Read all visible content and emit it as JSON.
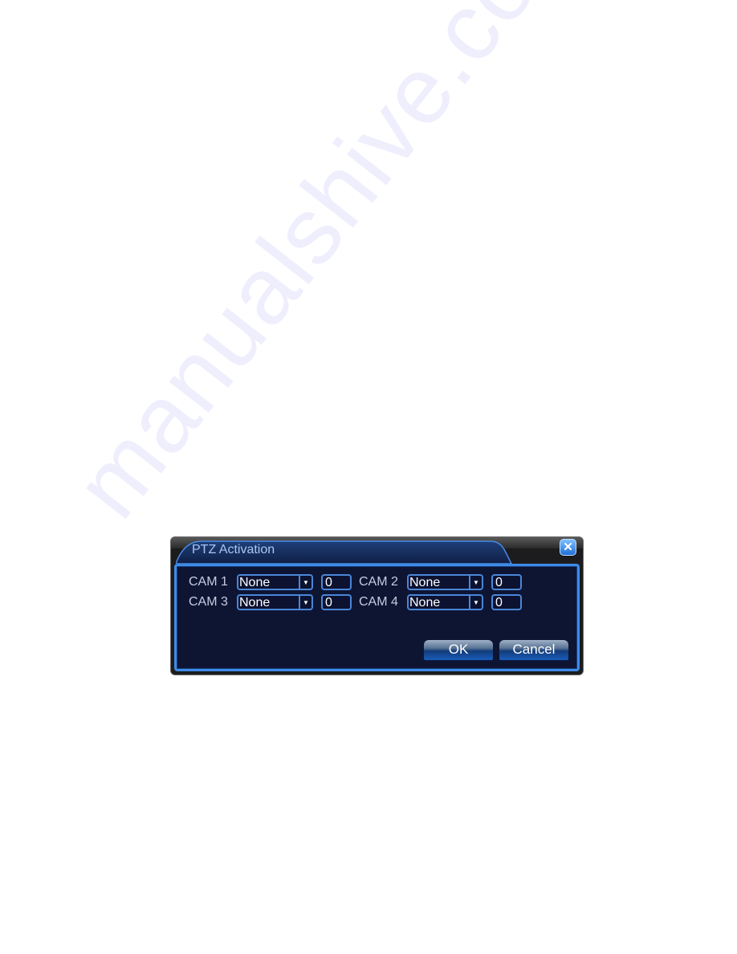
{
  "watermark": "manualshive.com",
  "dialog": {
    "title": "PTZ Activation",
    "close_icon": "close-icon",
    "rows": [
      [
        {
          "label": "CAM 1",
          "select": "None",
          "value": "0"
        },
        {
          "label": "CAM 2",
          "select": "None",
          "value": "0"
        }
      ],
      [
        {
          "label": "CAM 3",
          "select": "None",
          "value": "0"
        },
        {
          "label": "CAM 4",
          "select": "None",
          "value": "0"
        }
      ]
    ],
    "ok_label": "OK",
    "cancel_label": "Cancel",
    "dropdown_arrow": "▼",
    "close_glyph": "✕"
  },
  "colors": {
    "panel_bg": "#0e1533",
    "accent_border": "#3d8be8",
    "title_text": "#a9c6f2"
  }
}
